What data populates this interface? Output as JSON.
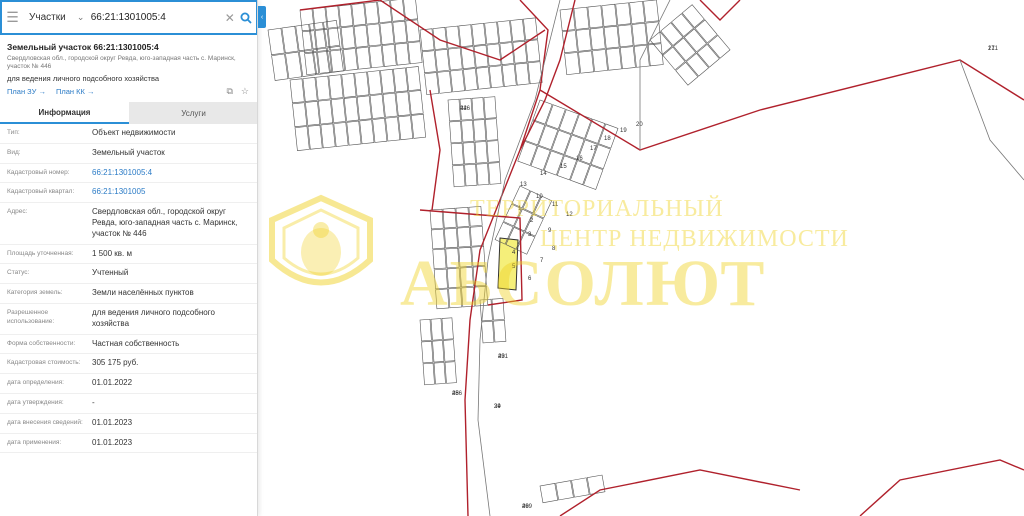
{
  "search": {
    "type_label": "Участки",
    "query": "66:21:1301005:4"
  },
  "parcel": {
    "title": "Земельный участок 66:21:1301005:4",
    "address_short": "Свердловская обл., городской округ Ревда, юго-западная часть с. Маринск, участок № 446",
    "use": "для ведения личного подсобного хозяйства",
    "plan_zu": "План ЗУ →",
    "plan_kk": "План КК →"
  },
  "tabs": [
    {
      "label": "Информация"
    },
    {
      "label": "Услуги"
    }
  ],
  "info_rows": [
    {
      "key": "Тип:",
      "value": "Объект недвижимости"
    },
    {
      "key": "Вид:",
      "value": "Земельный участок"
    },
    {
      "key": "Кадастровый номер:",
      "value": "66:21:1301005:4"
    },
    {
      "key": "Кадастровый квартал:",
      "value": "66:21:1301005"
    },
    {
      "key": "Адрес:",
      "value": "Свердловская обл., городской округ Ревда, юго-западная часть с. Маринск, участок № 446"
    },
    {
      "key": "Площадь уточненная:",
      "value": "1 500 кв. м"
    },
    {
      "key": "Статус:",
      "value": "Учтенный"
    },
    {
      "key": "Категория земель:",
      "value": "Земли населённых пунктов"
    },
    {
      "key": "Разрешенное использование:",
      "value": "для ведения личного подсобного хозяйства"
    },
    {
      "key": "Форма собственности:",
      "value": "Частная собственность"
    },
    {
      "key": "Кадастровая стоимость:",
      "value": "305 175 руб."
    },
    {
      "key": "дата определения:",
      "value": "01.01.2022"
    },
    {
      "key": "дата утверждения:",
      "value": "-"
    },
    {
      "key": "дата внесения сведений:",
      "value": "01.01.2023"
    },
    {
      "key": "дата применения:",
      "value": "01.01.2023"
    }
  ],
  "watermark": {
    "line1": "ТЕРРИТОРИАЛЬНЫЙ",
    "line2": "ЦЕНТР НЕДВИЖИМОСТИ",
    "brand": "АБСОЛЮТ"
  },
  "map": {
    "labels": [
      "171",
      "446",
      "491",
      "39",
      "486",
      "499",
      "1",
      "2",
      "3",
      "4",
      "5",
      "6",
      "7",
      "8",
      "9",
      "10",
      "11",
      "12",
      "13",
      "14",
      "15",
      "16",
      "17",
      "18",
      "19",
      "20",
      "21",
      "22",
      "23",
      "24",
      "25",
      "26"
    ],
    "boundary_color": "#b0212c",
    "grid_color": "#555555",
    "highlight_color": "#f5ef7a"
  }
}
